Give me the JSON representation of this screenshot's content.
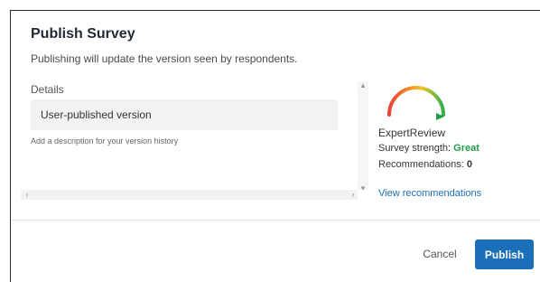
{
  "dialog": {
    "title": "Publish Survey",
    "subtitle": "Publishing will update the version seen by respondents."
  },
  "details": {
    "label": "Details",
    "version_value": "User-published version",
    "description_hint": "Add a description for your version history"
  },
  "expert_review": {
    "title": "ExpertReview",
    "strength_label": "Survey strength: ",
    "strength_value": "Great",
    "strength_color": "#1f9e46",
    "recommendations_label": "Recommendations: ",
    "recommendations_count": "0",
    "link_label": "View recommendations",
    "link_color": "#1a6fb8"
  },
  "footer": {
    "cancel_label": "Cancel",
    "publish_label": "Publish",
    "publish_color": "#1a6fb8"
  },
  "icons": {
    "gauge": "strength-gauge-icon",
    "scroll_up": "scroll-up-icon",
    "scroll_down": "scroll-down-icon",
    "scroll_left": "scroll-left-icon",
    "scroll_right": "scroll-right-icon"
  }
}
